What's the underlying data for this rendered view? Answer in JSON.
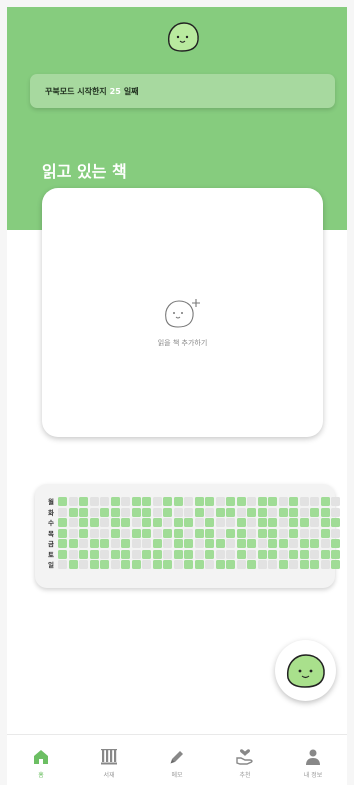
{
  "banner": {
    "prefix": "꾸북모드 시작한지",
    "days": "25",
    "suffix": "일째"
  },
  "reading": {
    "title": "읽고 있는 책",
    "add_label": "읽을 책 추가하기"
  },
  "grass": {
    "days": [
      "월",
      "화",
      "수",
      "목",
      "금",
      "토",
      "일"
    ],
    "columns": 27,
    "level_colors": [
      "#e2e2e2",
      "#a0dc96"
    ]
  },
  "nav": {
    "items": [
      {
        "label": "홈",
        "icon": "home-icon",
        "active": true
      },
      {
        "label": "서재",
        "icon": "bookshelf-icon",
        "active": false
      },
      {
        "label": "메모",
        "icon": "pencil-icon",
        "active": false
      },
      {
        "label": "추천",
        "icon": "heart-hand-icon",
        "active": false
      },
      {
        "label": "내 정보",
        "icon": "person-icon",
        "active": false
      }
    ]
  },
  "colors": {
    "brand_green": "#86cc7e",
    "nav_active": "#6cbf63"
  }
}
